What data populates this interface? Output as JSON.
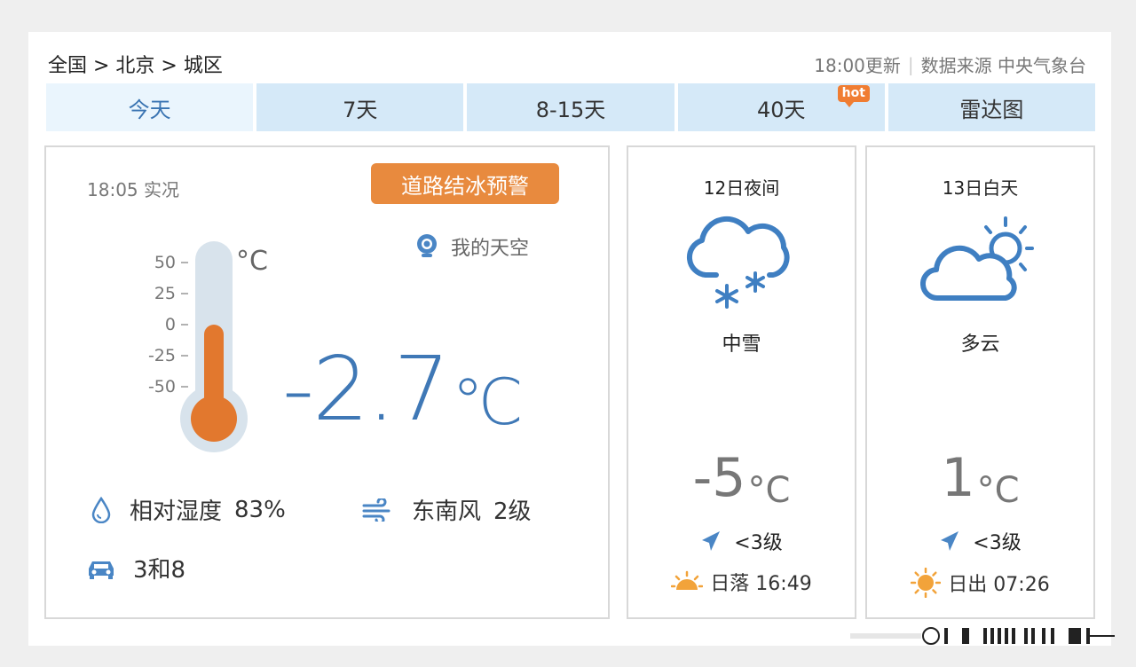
{
  "breadcrumb": "全国 > 北京 > 城区",
  "update": {
    "time": "18:00更新",
    "source": "数据来源 中央气象台"
  },
  "tabs": [
    {
      "label": "今天",
      "active": true
    },
    {
      "label": "7天"
    },
    {
      "label": "8-15天"
    },
    {
      "label": "40天",
      "badge": "hot"
    },
    {
      "label": "雷达图"
    }
  ],
  "current": {
    "obs_time": "18:05 实况",
    "warning": "道路结冰预警",
    "my_sky": "我的天空",
    "temp": "-2.7",
    "unit": "℃",
    "thermo_unit": "°C",
    "thermo_ticks": [
      "50",
      "25",
      "0",
      "-25",
      "-50"
    ],
    "humidity_label": "相对湿度",
    "humidity_value": "83%",
    "wind_dir": "东南风",
    "wind_level": "2级",
    "traffic_limit": "3和8"
  },
  "night": {
    "title": "12日夜间",
    "icon": "snow-cloud-icon",
    "weather": "中雪",
    "temp": "-5",
    "unit": "°C",
    "wind": "<3级",
    "sun_label": "日落 16:49"
  },
  "day": {
    "title": "13日白天",
    "icon": "partly-cloudy-icon",
    "weather": "多云",
    "temp": "1",
    "unit": "°C",
    "wind": "<3级",
    "sun_label": "日出 07:26"
  },
  "colors": {
    "accent_blue": "#3f78b6",
    "tab_bg": "#d5e9f8",
    "warning_orange": "#e88a3e",
    "sun_orange": "#f2a33a"
  }
}
